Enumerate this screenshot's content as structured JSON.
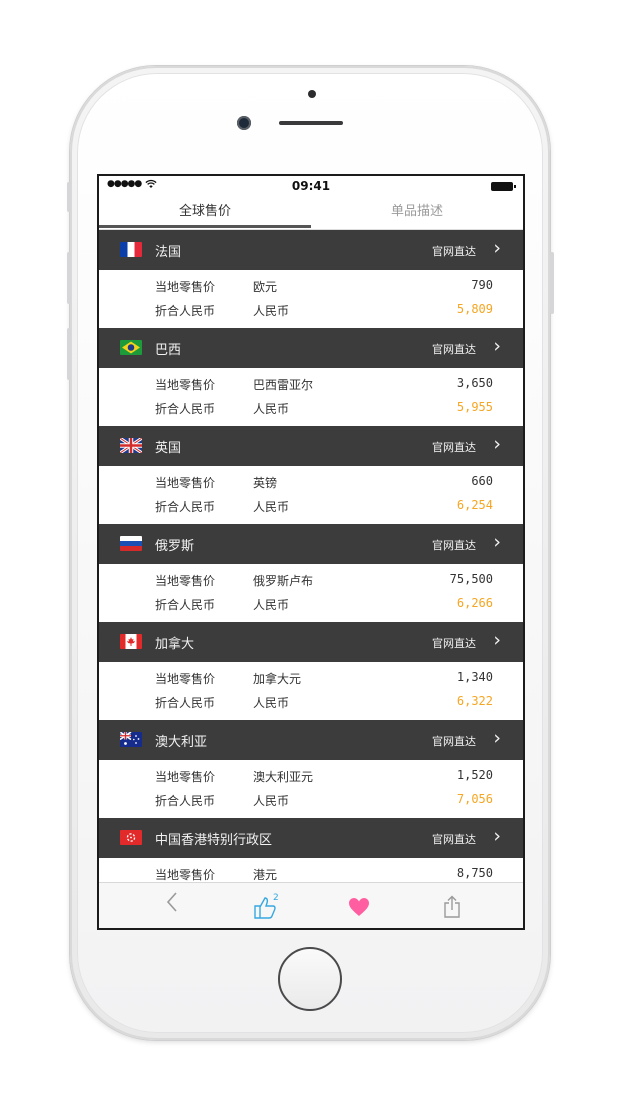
{
  "status_bar": {
    "signal": "●●●●●",
    "time": "09:41"
  },
  "tabs": [
    {
      "label": "全球售价",
      "active": true
    },
    {
      "label": "单品描述",
      "active": false
    }
  ],
  "official_link_label": "官网直达",
  "labels": {
    "local_price": "当地零售价",
    "cny_price": "折合人民币",
    "cny_currency": "人民币"
  },
  "countries": [
    {
      "name": "法国",
      "flag": "france-flag-icon",
      "currency": "欧元",
      "local_price": "790",
      "cny_price": "5,809"
    },
    {
      "name": "巴西",
      "flag": "brazil-flag-icon",
      "currency": "巴西雷亚尔",
      "local_price": "3,650",
      "cny_price": "5,955"
    },
    {
      "name": "英国",
      "flag": "uk-flag-icon",
      "currency": "英镑",
      "local_price": "660",
      "cny_price": "6,254"
    },
    {
      "name": "俄罗斯",
      "flag": "russia-flag-icon",
      "currency": "俄罗斯卢布",
      "local_price": "75,500",
      "cny_price": "6,266"
    },
    {
      "name": "加拿大",
      "flag": "canada-flag-icon",
      "currency": "加拿大元",
      "local_price": "1,340",
      "cny_price": "6,322"
    },
    {
      "name": "澳大利亚",
      "flag": "australia-flag-icon",
      "currency": "澳大利亚元",
      "local_price": "1,520",
      "cny_price": "7,056"
    },
    {
      "name": "中国香港特别行政区",
      "flag": "hong-kong-flag-icon",
      "currency": "港元",
      "local_price": "8,750"
    }
  ],
  "toolbar": {
    "like_count": "2",
    "colors": {
      "back": "#9a9a9a",
      "like": "#36a8e0",
      "heart": "#ff5fa0",
      "share": "#9a9a9a"
    }
  },
  "colors": {
    "header_bg": "#3c3c3c",
    "cny_accent": "#f5a623"
  }
}
